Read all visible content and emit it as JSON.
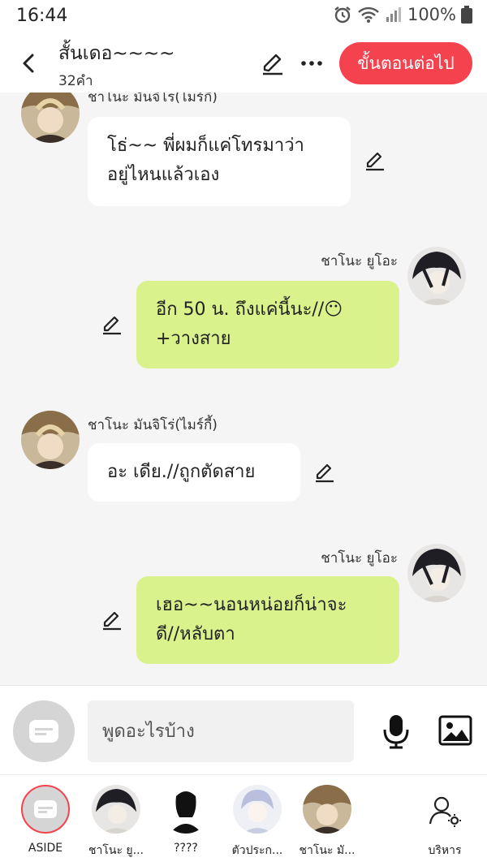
{
  "status_bar": {
    "time": "16:44",
    "battery": "100%"
  },
  "header": {
    "title": "สั้นเดอ~~~~",
    "word_count": "32คำ",
    "next_button": "ขั้นตอนต่อไป",
    "accent_color": "#f4424f"
  },
  "messages": [
    {
      "side": "left",
      "sender": "ชาโนะ มันจิโร่(ไมร์กี้)",
      "text_line1": "โธ่~~ พี่ผมก็แค่โทรมาว่า",
      "text_line2": "อยู่ไหนแล้วเอง"
    },
    {
      "side": "right",
      "sender": "ชาโนะ ยูโอะ",
      "text_line1": "อีก 50 น. ถึงแค่นี้นะ//😶",
      "text_line2": "+วางสาย"
    },
    {
      "side": "left",
      "sender": "ชาโนะ มันจิโร่(ไมร์กี้)",
      "text_line1": "อะ เดีย.//ถูกตัดสาย"
    },
    {
      "side": "right",
      "sender": "ชาโนะ ยูโอะ",
      "text_line1": "เฮอ~~นอนหน่อยก็น่าจะ",
      "text_line2": "ดี//หลับตา"
    }
  ],
  "input": {
    "placeholder": "พูดอะไรบ้าง"
  },
  "bottom_nav": [
    {
      "label": "ASIDE"
    },
    {
      "label": "ชาโนะ ยู..."
    },
    {
      "label": "????"
    },
    {
      "label": "ตัวประก..."
    },
    {
      "label": "ชาโนะ มั..."
    },
    {
      "label": "บริหาร"
    }
  ],
  "colors": {
    "bubble_right": "#d9f28c",
    "bubble_left": "#ffffff",
    "background": "#f5f5f5"
  },
  "icons": [
    "back-arrow-icon",
    "pencil-icon",
    "more-icon",
    "mic-icon",
    "image-icon",
    "chat-icon",
    "manage-user-icon",
    "alarm-icon",
    "wifi-icon",
    "signal-icon",
    "battery-icon"
  ]
}
